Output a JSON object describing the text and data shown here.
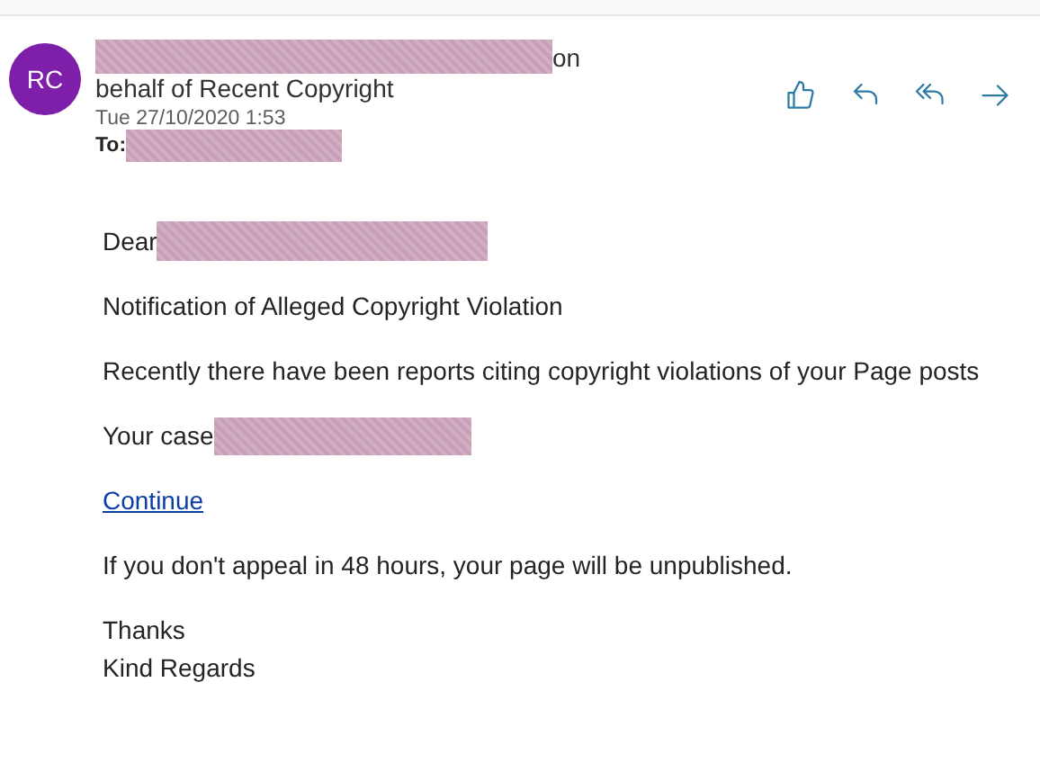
{
  "sender": {
    "avatar_initials": "RC",
    "name_suffix": "on",
    "name_line2": "behalf of Recent Copyright",
    "date": "Tue 27/10/2020 1:53",
    "to_label": "To:"
  },
  "body": {
    "greeting": "Dear",
    "subject_line": "Notification of Alleged Copyright Violation",
    "paragraph": "Recently there have been reports citing copyright violations of your Page posts",
    "case_label": "Your case",
    "link": "Continue",
    "warning": "If you don't appeal in 48 hours, your page will be unpublished.",
    "closing": [
      "Thanks",
      "Kind Regards"
    ]
  }
}
